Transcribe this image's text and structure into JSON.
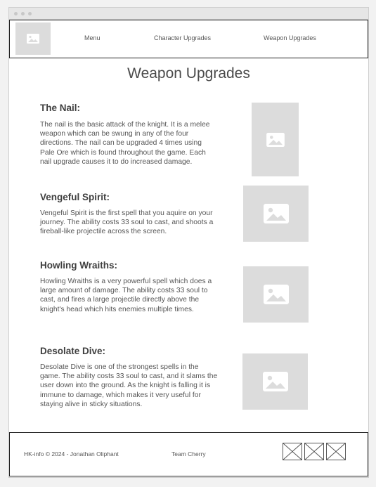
{
  "nav": {
    "links": [
      "Menu",
      "Character Upgrades",
      "Weapon Upgrades"
    ]
  },
  "page": {
    "title": "Weapon Upgrades"
  },
  "sections": [
    {
      "heading": "The Nail:",
      "text": "The nail is the basic attack of the knight. It is a melee weapon which can be swung in any of the four directions. The nail can be upgraded 4 times using Pale Ore which is found throughout the game. Each nail upgrade causes it to do increased damage."
    },
    {
      "heading": "Vengeful Spirit:",
      "text": "Vengeful Spirit is the first spell that you aquire on your journey. The ability costs 33 soul to cast, and shoots a fireball-like projectile across the screen."
    },
    {
      "heading": "Howling Wraiths:",
      "text": "Howling Wraiths is a very powerful spell which does a large amount of damage. The ability costs 33 soul to cast, and fires a large projectile directly above the knight's head which hits enemies multiple times."
    },
    {
      "heading": "Desolate Dive:",
      "text": "Desolate Dive is one of the strongest spells in the game. The ability costs 33 soul to cast, and it slams the user down into the ground. As the knight is falling it is immune to damage, which makes it very useful for staying alive in sticky situations."
    }
  ],
  "footer": {
    "copyright": "HK-info © 2024 - Jonathan Oliphant",
    "credit": "Team Cherry"
  },
  "icons": {
    "image_placeholder": "image-placeholder-icon",
    "social": "broken-image-icon"
  },
  "colors": {
    "placeholder_bg": "#dcdcdc",
    "placeholder_icon": "#ffffff",
    "border": "#222222",
    "text": "#4a4a4a"
  }
}
